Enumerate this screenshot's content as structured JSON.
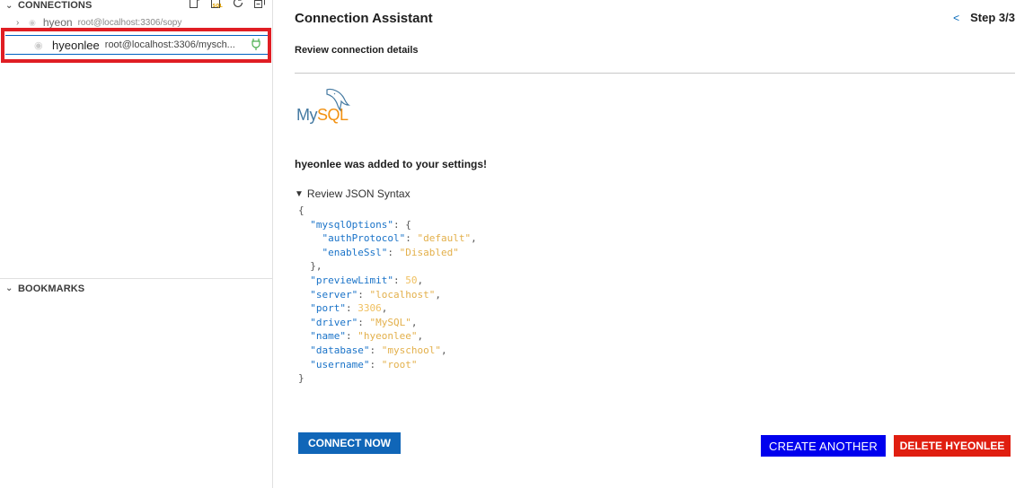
{
  "sidebar": {
    "connections_header": "CONNECTIONS",
    "bookmarks_header": "BOOKMARKS",
    "toolbar_icons": [
      "new-connection-icon",
      "new-sql-file-icon",
      "refresh-icon",
      "collapse-all-icon"
    ],
    "connections": [
      {
        "name": "hyeon",
        "desc": "root@localhost:3306/sopy"
      },
      {
        "name": "hyeonlee",
        "desc": "root@localhost:3306/mysch..."
      }
    ]
  },
  "assistant": {
    "title": "Connection Assistant",
    "step_back": "<",
    "step": "Step 3/3",
    "subtitle": "Review connection details",
    "logo_my": "My",
    "logo_sql": "SQL",
    "added_message": "hyeonlee was added to your settings!",
    "json_toggle": "Review JSON Syntax",
    "json": {
      "open": "{",
      "mysql_key": "\"mysqlOptions\"",
      "open_inner": "{",
      "auth_key": "\"authProtocol\"",
      "auth_val": "\"default\"",
      "ssl_key": "\"enableSsl\"",
      "ssl_val": "\"Disabled\"",
      "close_inner": "},",
      "preview_key": "\"previewLimit\"",
      "preview_val": "50",
      "server_key": "\"server\"",
      "server_val": "\"localhost\"",
      "port_key": "\"port\"",
      "port_val": "3306",
      "driver_key": "\"driver\"",
      "driver_val": "\"MySQL\"",
      "name_key": "\"name\"",
      "name_val": "\"hyeonlee\"",
      "database_key": "\"database\"",
      "database_val": "\"myschool\"",
      "username_key": "\"username\"",
      "username_val": "\"root\"",
      "close": "}"
    },
    "buttons": {
      "connect": "CONNECT NOW",
      "create": "CREATE ANOTHER",
      "delete": "DELETE HYEONLEE"
    }
  },
  "colors": {
    "highlight": "#e01e24",
    "connect_button": "#1066b8",
    "create_button": "#0000ee",
    "delete_button": "#e01e10",
    "json_key": "#1a73c8",
    "json_string": "#e3b04b"
  }
}
